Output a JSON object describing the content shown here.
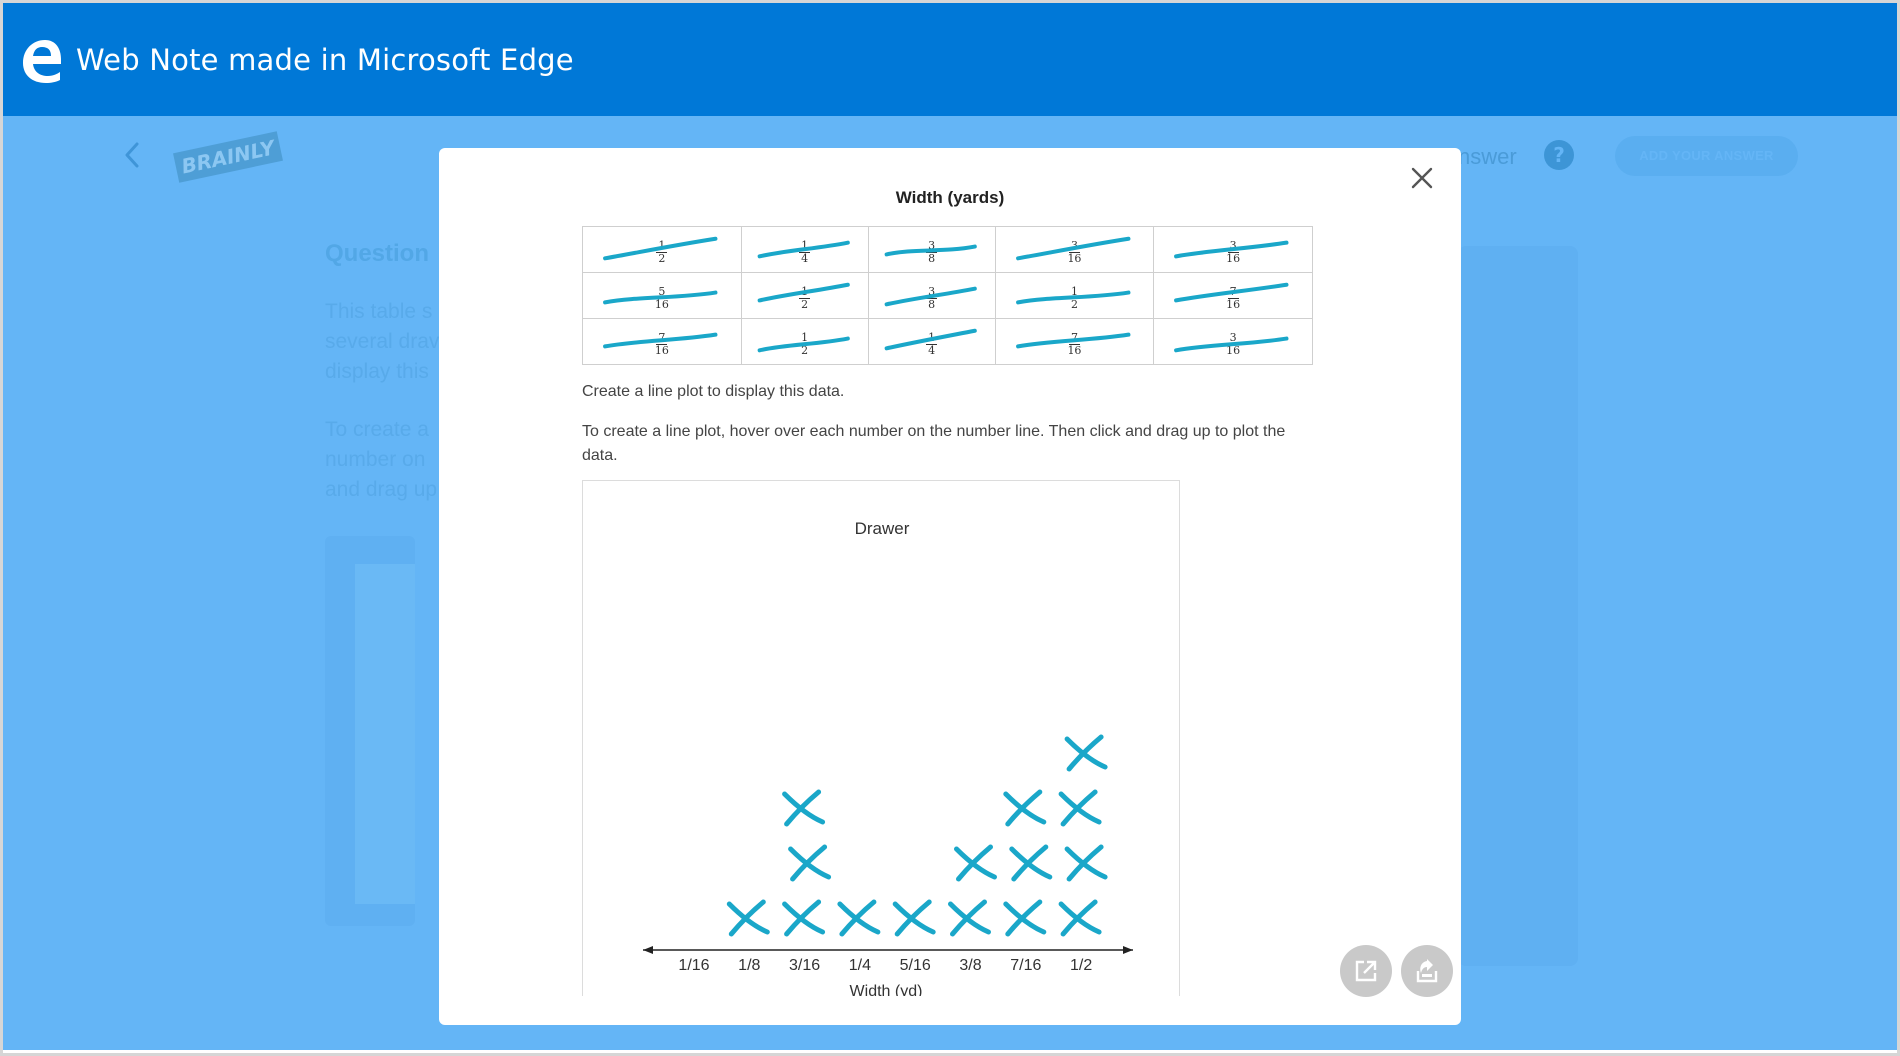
{
  "window": {
    "title": "Web Note made in Microsoft Edge",
    "icon": "edge-icon"
  },
  "background_page": {
    "logo_text": "BRAINLY",
    "answer_text": "nswer",
    "help_symbol": "?",
    "add_button_label": "ADD YOUR ANSWER",
    "question_title": "Question",
    "question_lines": [
      "This table s",
      "several drav",
      "display this"
    ],
    "instruction_lines": [
      "To create a",
      "number on",
      "and drag up"
    ]
  },
  "modal": {
    "table": {
      "title": "Width (yards)",
      "rows": [
        [
          {
            "num": "1",
            "den": "2"
          },
          {
            "num": "1",
            "den": "4"
          },
          {
            "num": "3",
            "den": "8"
          },
          {
            "num": "3",
            "den": "16"
          },
          {
            "num": "3",
            "den": "16"
          }
        ],
        [
          {
            "num": "5",
            "den": "16"
          },
          {
            "num": "1",
            "den": "2"
          },
          {
            "num": "3",
            "den": "8"
          },
          {
            "num": "1",
            "den": "2"
          },
          {
            "num": "7",
            "den": "16"
          }
        ],
        [
          {
            "num": "7",
            "den": "16"
          },
          {
            "num": "1",
            "den": "2"
          },
          {
            "num": "1",
            "den": "4"
          },
          {
            "num": "7",
            "den": "16"
          },
          {
            "num": "3",
            "den": "16"
          }
        ]
      ]
    },
    "instruction_1": "Create a line plot to display this data.",
    "instruction_2": "To create a line plot, hover over each number on the number line. Then click and drag up to plot the data.",
    "plot": {
      "title": "Drawer",
      "ink_color": "#1aa7c9"
    }
  },
  "chart_data": {
    "type": "scatter",
    "title": "Drawer",
    "xlabel": "Width (yd)",
    "ylabel": "",
    "categories": [
      "1/16",
      "1/8",
      "3/16",
      "1/4",
      "5/16",
      "3/8",
      "7/16",
      "1/2"
    ],
    "counts": [
      0,
      1,
      3,
      1,
      1,
      2,
      3,
      4
    ],
    "marks": [
      {
        "x": "1/8",
        "count": 1
      },
      {
        "x": "3/16",
        "count": 3
      },
      {
        "x": "1/4",
        "count": 1
      },
      {
        "x": "5/16",
        "count": 1
      },
      {
        "x": "3/8",
        "count": 2
      },
      {
        "x": "7/16",
        "count": 3
      },
      {
        "x": "1/2",
        "count": 4
      }
    ],
    "marker": "X",
    "grid": false
  },
  "buttons": {
    "close_icon": "close-icon",
    "open_external_icon": "open-external-icon",
    "share_icon": "share-icon"
  }
}
